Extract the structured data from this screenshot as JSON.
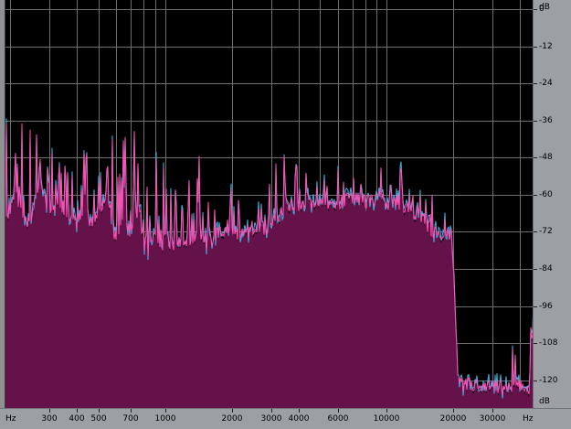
{
  "axes": {
    "db_unit": "dB",
    "db_labels": [
      "0",
      "-12",
      "-24",
      "-36",
      "-48",
      "-60",
      "-72",
      "-84",
      "-96",
      "-108",
      "-120"
    ],
    "db_unit_bottom": "dB",
    "freq_unit_left": "Hz",
    "freq_unit_right": "Hz",
    "freq_labels": [
      {
        "text": "300",
        "hz": 300
      },
      {
        "text": "400",
        "hz": 400
      },
      {
        "text": "500",
        "hz": 500
      },
      {
        "text": "700",
        "hz": 700
      },
      {
        "text": "1000",
        "hz": 1000
      },
      {
        "text": "2000",
        "hz": 2000
      },
      {
        "text": "3000",
        "hz": 3000
      },
      {
        "text": "4000",
        "hz": 4000
      },
      {
        "text": "6000",
        "hz": 6000
      },
      {
        "text": "10000",
        "hz": 10000
      },
      {
        "text": "20000",
        "hz": 20000
      },
      {
        "text": "30000",
        "hz": 30000
      }
    ]
  },
  "colors": {
    "background": "#000000",
    "grid": "#6e6e6e",
    "fill": "#66124a",
    "trace_left": "#3db8e6",
    "trace_right": "#ff4fb0"
  },
  "chart_data": {
    "type": "area",
    "xscale": "log",
    "xlim": [
      190,
      46000
    ],
    "ylim": [
      -129,
      3
    ],
    "series": [
      {
        "values_x": [
          190,
          210,
          240,
          270,
          300,
          330,
          360,
          400,
          430,
          470,
          500,
          560,
          600,
          650,
          700,
          760,
          800,
          850,
          900,
          950,
          1000,
          1100,
          1200,
          1300,
          1400,
          1500,
          1700,
          1900,
          2100,
          2300,
          2600,
          2900,
          3200,
          3600,
          4000,
          4500,
          5000,
          5500,
          6000,
          7000,
          8000,
          9000,
          10000,
          11000,
          12000,
          14000,
          16000,
          18000,
          19500,
          20000,
          20500,
          21000,
          22000,
          24000,
          27000,
          30000,
          35000,
          40000,
          44000,
          46000
        ],
        "values_y": [
          -68,
          -60,
          -70,
          -57,
          -66,
          -62,
          -66,
          -69,
          -63,
          -70,
          -65,
          -62,
          -76,
          -67,
          -72,
          -64,
          -76,
          -79,
          -72,
          -78,
          -73,
          -77,
          -75,
          -74,
          -72,
          -76,
          -73,
          -72,
          -73,
          -72,
          -70,
          -71,
          -67,
          -64,
          -63,
          -62,
          -63,
          -62,
          -63,
          -61,
          -62,
          -61,
          -63,
          -62,
          -64,
          -66,
          -72,
          -74,
          -72,
          -82,
          -105,
          -120,
          -122,
          -121,
          -123,
          -122,
          -123,
          -121,
          -123,
          -98
        ]
      }
    ]
  }
}
